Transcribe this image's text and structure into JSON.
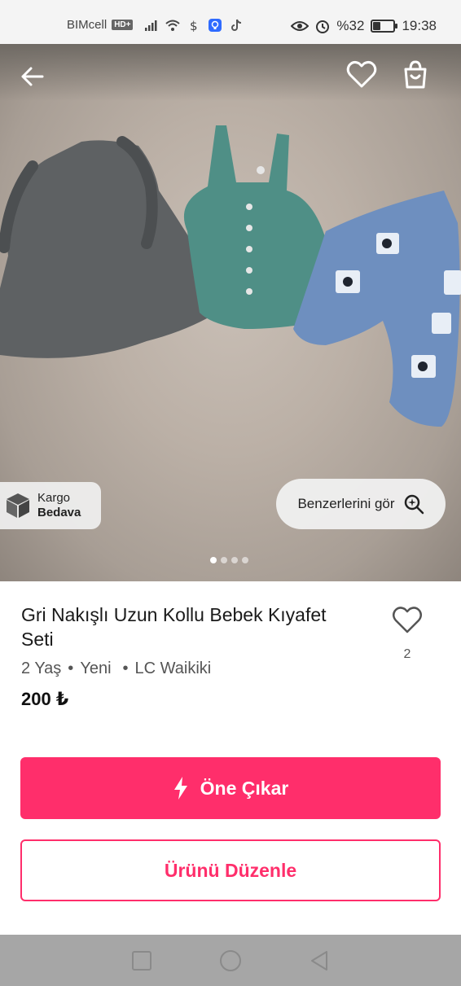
{
  "status_bar": {
    "carrier": "BIMcell",
    "network_badge": "HD+",
    "battery_text": "%32",
    "battery_level": 0.32,
    "time": "19:38"
  },
  "header": {
    "back_icon": "arrow-left-icon",
    "favorite_icon": "heart-outline-icon",
    "bag_icon": "shopping-bag-icon"
  },
  "hero": {
    "cargo_line1": "Kargo",
    "cargo_line2": "Bedava",
    "similar_label": "Benzerlerini gör",
    "carousel_count": 4,
    "carousel_active": 0
  },
  "product": {
    "title": "Gri Nakışlı Uzun Kollu Bebek Kıyafet Seti",
    "size": "2 Yaş",
    "condition": "Yeni",
    "brand": "LC Waikiki",
    "price": "200 ₺",
    "favorite_count": "2"
  },
  "actions": {
    "promote_label": "Öne Çıkar",
    "edit_label": "Ürünü Düzenle"
  },
  "colors": {
    "accent": "#ff2e6b"
  }
}
